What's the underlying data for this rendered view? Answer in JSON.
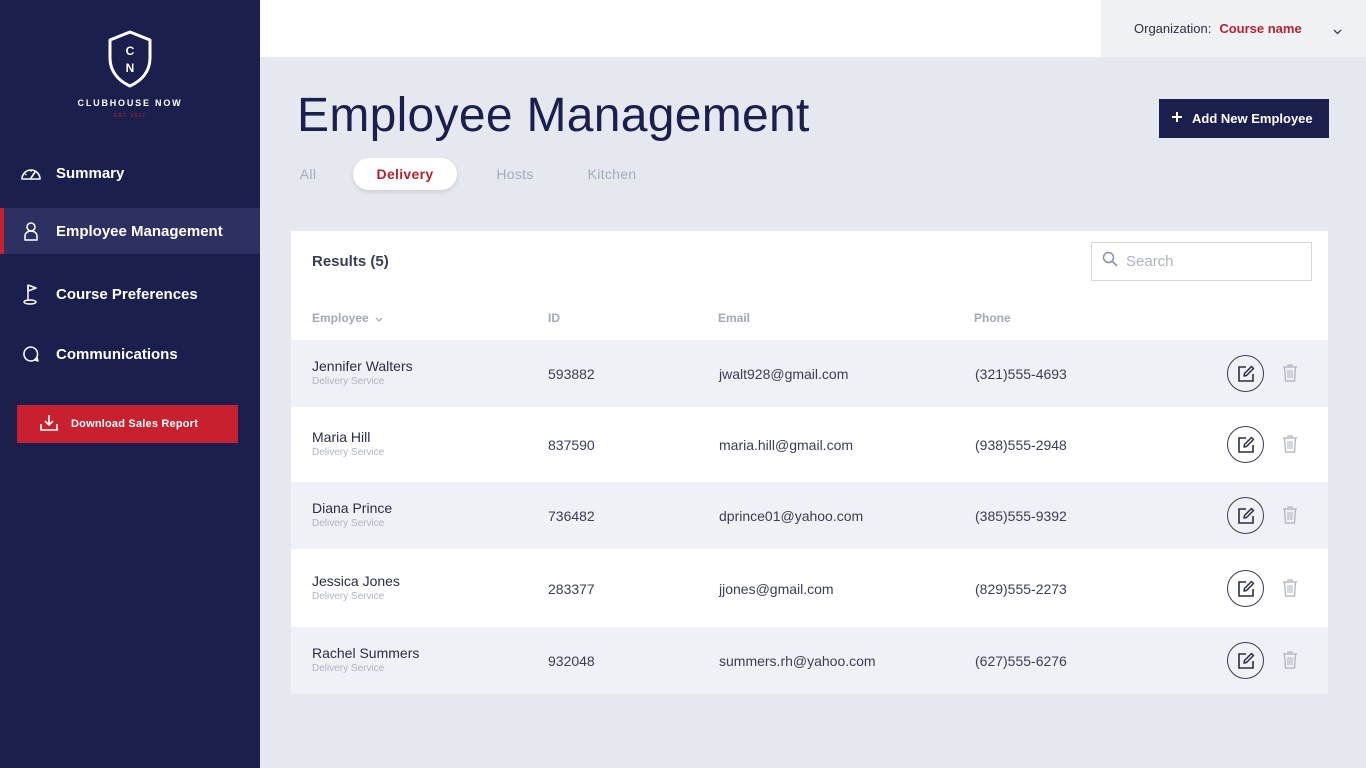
{
  "sidebar": {
    "logo": {
      "monogram_top": "C",
      "monogram_bottom": "N",
      "name": "CLUBHOUSE NOW",
      "established": "EST. 2017"
    },
    "nav": [
      {
        "label": "Summary",
        "icon": "gauge-icon",
        "active": false
      },
      {
        "label": "Employee Management",
        "icon": "person-icon",
        "active": true
      },
      {
        "label": "Course Preferences",
        "icon": "golf-flag-icon",
        "active": false
      },
      {
        "label": "Communications",
        "icon": "chat-bubble-icon",
        "active": false
      }
    ],
    "download_label": "Download Sales Report"
  },
  "topbar": {
    "org_label": "Organization:",
    "org_value": "Course name"
  },
  "header": {
    "title": "Employee Management",
    "add_label": "Add New Employee"
  },
  "tabs": [
    {
      "label": "All",
      "active": false
    },
    {
      "label": "Delivery",
      "active": true
    },
    {
      "label": "Hosts",
      "active": false
    },
    {
      "label": "Kitchen",
      "active": false
    }
  ],
  "table": {
    "results_label": "Results (5)",
    "search_placeholder": "Search",
    "columns": [
      "Employee",
      "ID",
      "Email",
      "Phone"
    ],
    "rows": [
      {
        "name": "Jennifer Walters",
        "role": "Delivery Service",
        "id": "593882",
        "email": "jwalt928@gmail.com",
        "phone": "(321)555-4693"
      },
      {
        "name": "Maria Hill",
        "role": "Delivery Service",
        "id": "837590",
        "email": "maria.hill@gmail.com",
        "phone": "(938)555-2948"
      },
      {
        "name": "Diana Prince",
        "role": "Delivery Service",
        "id": "736482",
        "email": "dprince01@yahoo.com",
        "phone": "(385)555-9392"
      },
      {
        "name": "Jessica Jones",
        "role": "Delivery Service",
        "id": "283377",
        "email": "jjones@gmail.com",
        "phone": "(829)555-2273"
      },
      {
        "name": "Rachel Summers",
        "role": "Delivery Service",
        "id": "932048",
        "email": "summers.rh@yahoo.com",
        "phone": "(627)555-6276"
      }
    ]
  },
  "colors": {
    "sidebar_bg": "#1b1f4d",
    "accent_red": "#c8202f",
    "page_bg": "#e6e8f0",
    "row_shade": "#eff1f6"
  }
}
